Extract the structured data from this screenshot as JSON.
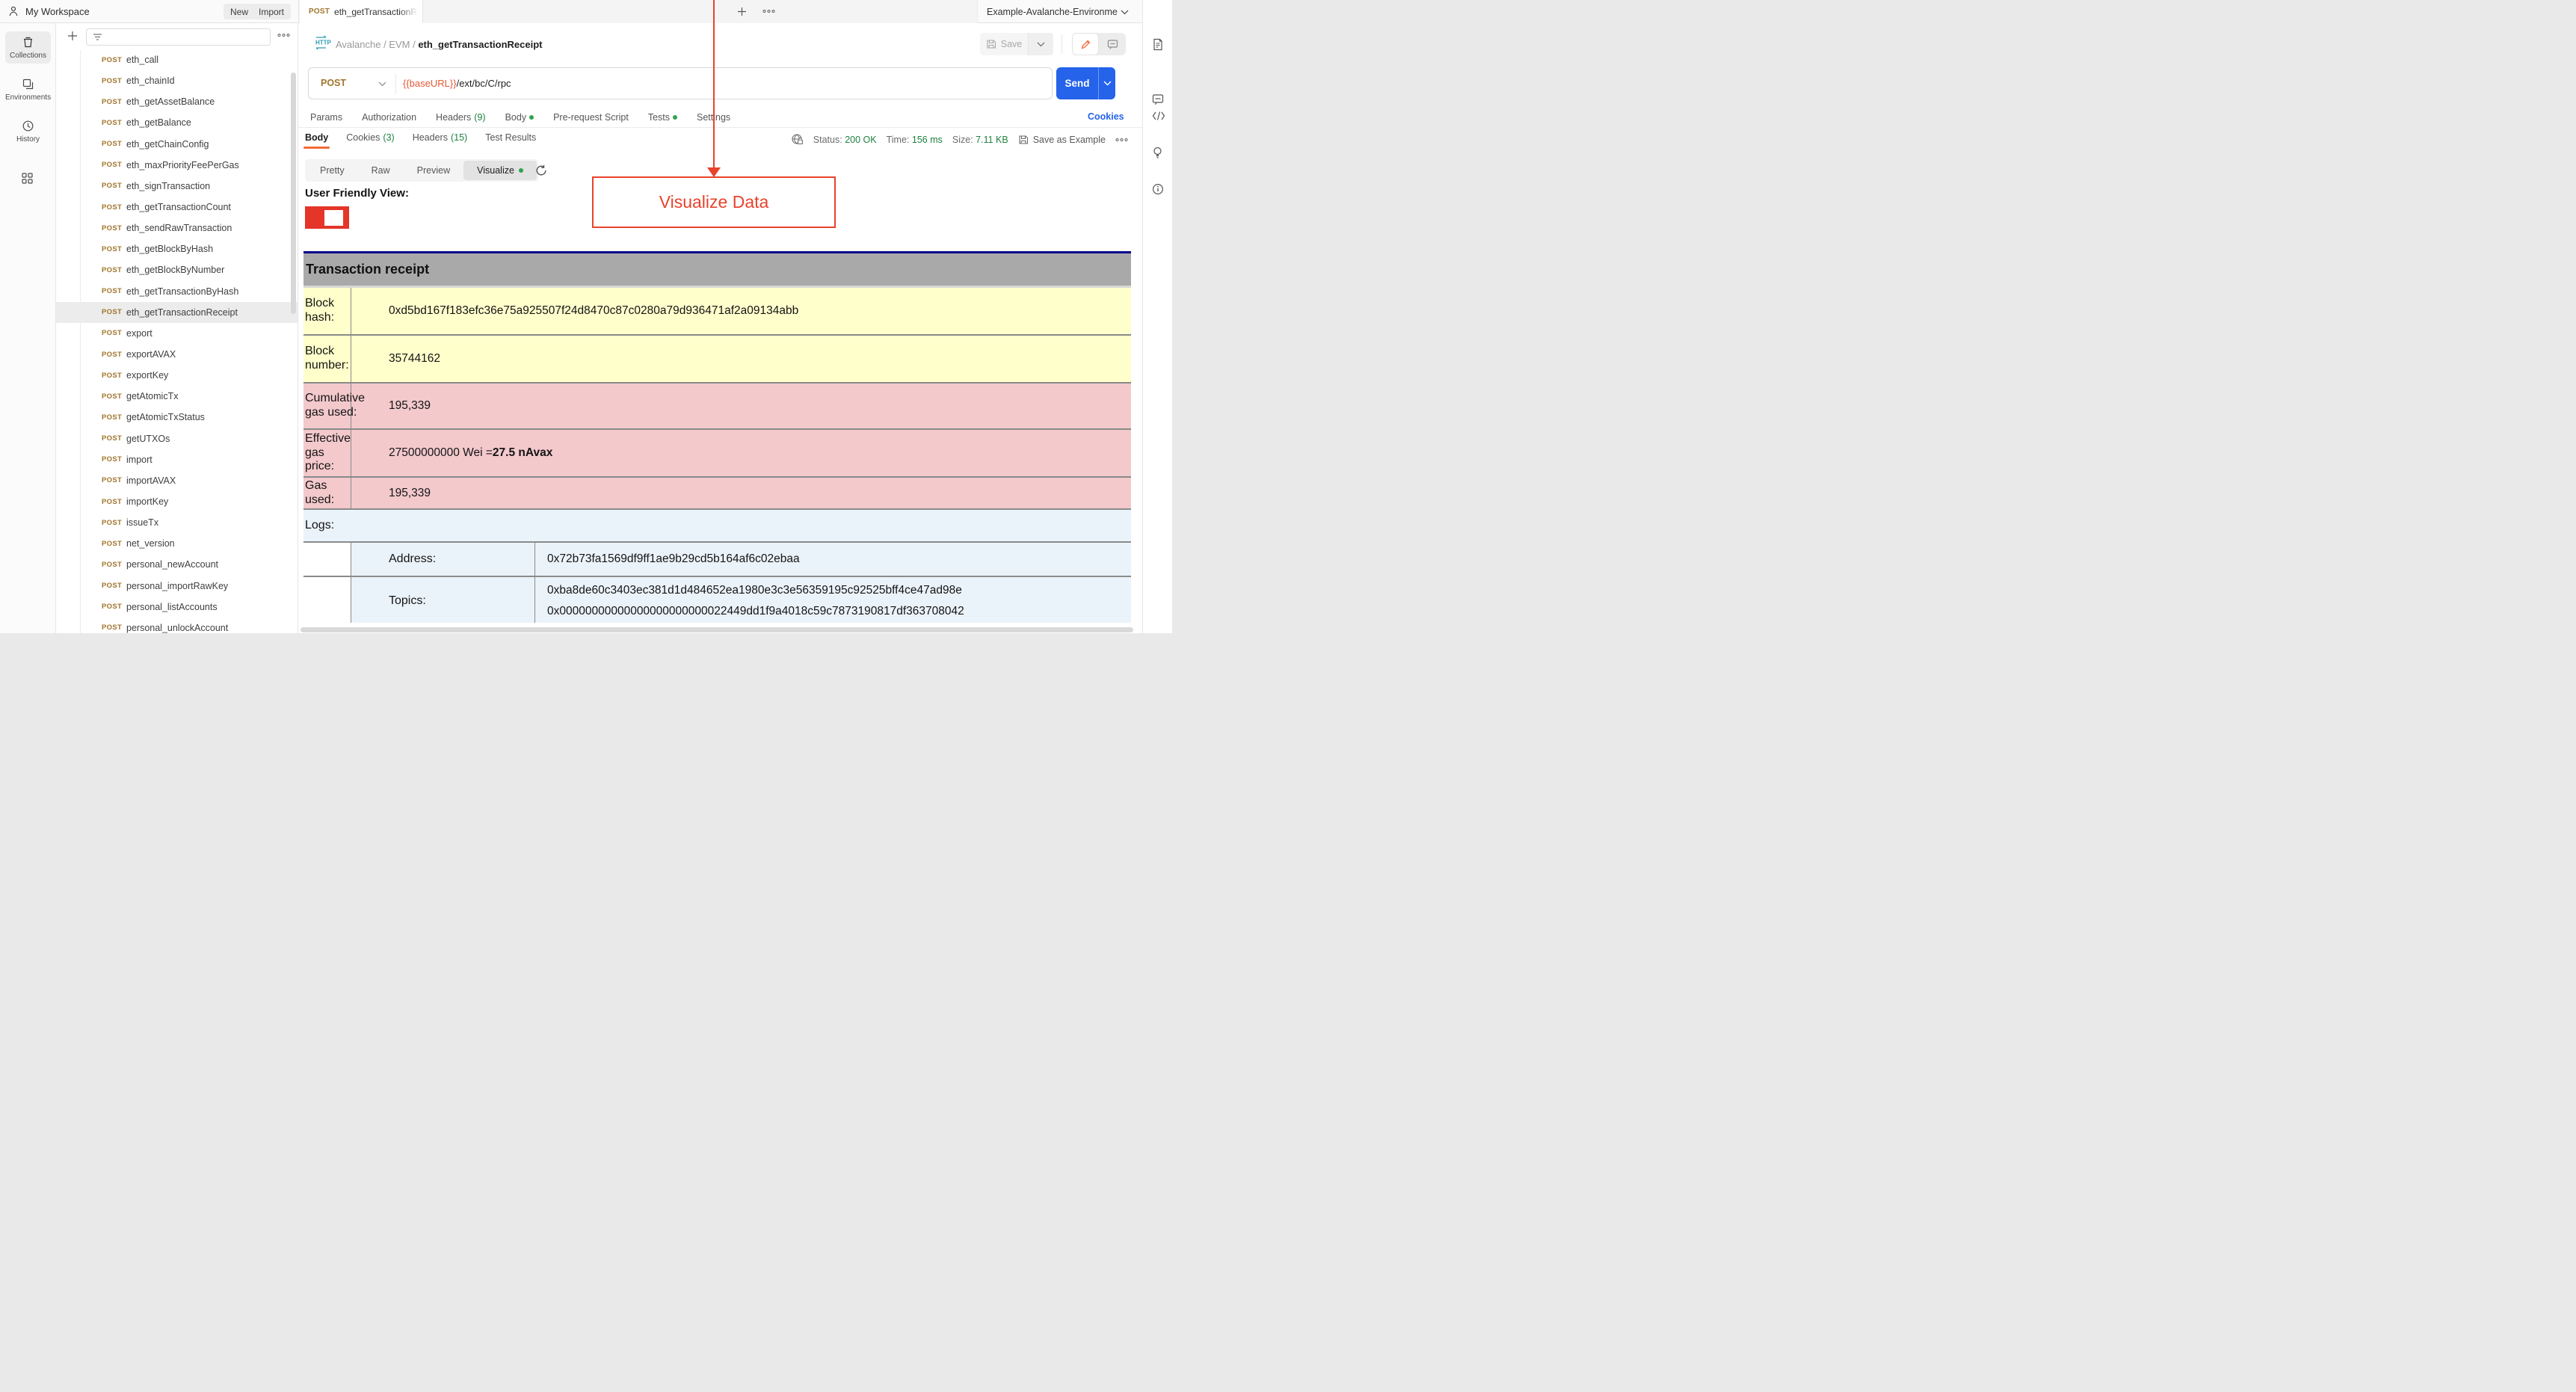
{
  "topbar": {
    "workspace_title": "My Workspace",
    "new_button": "New",
    "import_button": "Import",
    "tab_method": "POST",
    "tab_title": "eth_getTransactionRece",
    "environment_name": "Example-Avalanche-Environme"
  },
  "left_rail": {
    "collections_label": "Collections",
    "environments_label": "Environments",
    "history_label": "History"
  },
  "sidebar": {
    "selected_index": 12,
    "items": [
      {
        "method": "POST",
        "name": "eth_call"
      },
      {
        "method": "POST",
        "name": "eth_chainId"
      },
      {
        "method": "POST",
        "name": "eth_getAssetBalance"
      },
      {
        "method": "POST",
        "name": "eth_getBalance"
      },
      {
        "method": "POST",
        "name": "eth_getChainConfig"
      },
      {
        "method": "POST",
        "name": "eth_maxPriorityFeePerGas"
      },
      {
        "method": "POST",
        "name": "eth_signTransaction"
      },
      {
        "method": "POST",
        "name": "eth_getTransactionCount"
      },
      {
        "method": "POST",
        "name": "eth_sendRawTransaction"
      },
      {
        "method": "POST",
        "name": "eth_getBlockByHash"
      },
      {
        "method": "POST",
        "name": "eth_getBlockByNumber"
      },
      {
        "method": "POST",
        "name": "eth_getTransactionByHash"
      },
      {
        "method": "POST",
        "name": "eth_getTransactionReceipt"
      },
      {
        "method": "POST",
        "name": "export"
      },
      {
        "method": "POST",
        "name": "exportAVAX"
      },
      {
        "method": "POST",
        "name": "exportKey"
      },
      {
        "method": "POST",
        "name": "getAtomicTx"
      },
      {
        "method": "POST",
        "name": "getAtomicTxStatus"
      },
      {
        "method": "POST",
        "name": "getUTXOs"
      },
      {
        "method": "POST",
        "name": "import"
      },
      {
        "method": "POST",
        "name": "importAVAX"
      },
      {
        "method": "POST",
        "name": "importKey"
      },
      {
        "method": "POST",
        "name": "issueTx"
      },
      {
        "method": "POST",
        "name": "net_version"
      },
      {
        "method": "POST",
        "name": "personal_newAccount"
      },
      {
        "method": "POST",
        "name": "personal_importRawKey"
      },
      {
        "method": "POST",
        "name": "personal_listAccounts"
      },
      {
        "method": "POST",
        "name": "personal_unlockAccount"
      }
    ]
  },
  "request": {
    "breadcrumb": [
      "Avalanche",
      "EVM"
    ],
    "breadcrumb_current": "eth_getTransactionReceipt",
    "save_button": "Save",
    "method": "POST",
    "url_variable": "{{baseURL}}",
    "url_path": "/ext/bc/C/rpc",
    "send_button": "Send",
    "tabs": [
      {
        "label": "Params"
      },
      {
        "label": "Authorization"
      },
      {
        "label": "Headers",
        "count": "(9)"
      },
      {
        "label": "Body",
        "dot": true
      },
      {
        "label": "Pre-request Script"
      },
      {
        "label": "Tests",
        "dot": true
      },
      {
        "label": "Settings"
      }
    ],
    "cookies_link": "Cookies"
  },
  "response": {
    "tabs": [
      {
        "label": "Body",
        "active": true
      },
      {
        "label": "Cookies",
        "count": "(3)"
      },
      {
        "label": "Headers",
        "count": "(15)"
      },
      {
        "label": "Test Results"
      }
    ],
    "status_label": "Status:",
    "status_value": "200 OK",
    "time_label": "Time:",
    "time_value": "156 ms",
    "size_label": "Size:",
    "size_value": "7.11 KB",
    "save_as_example": "Save as Example",
    "view_tabs": [
      {
        "label": "Pretty"
      },
      {
        "label": "Raw"
      },
      {
        "label": "Preview"
      },
      {
        "label": "Visualize",
        "active": true,
        "dot": true
      }
    ]
  },
  "visualizer": {
    "heading": "User Friendly View:",
    "annotation_label": "Visualize Data",
    "table": {
      "title": "Transaction receipt",
      "rows": [
        {
          "label": "Block hash:",
          "value": "0xd5bd167f183efc36e75a925507f24d8470c87c0280a79d936471af2a09134abb",
          "bg": "yellow",
          "height": 62
        },
        {
          "label": "Block number:",
          "value": "35744162",
          "bg": "yellow",
          "height": 62
        },
        {
          "label": "Cumulative gas used:",
          "value": "195,339",
          "bg": "pink",
          "height": 60
        },
        {
          "label": "Effective gas price:",
          "value": "27500000000 Wei = ",
          "value_bold": "27.5 nAvax",
          "bg": "pink",
          "height": 62
        },
        {
          "label": "Gas used:",
          "value": "195,339",
          "bg": "pink",
          "height": 41
        }
      ],
      "logs_label": "Logs:",
      "logs_height": 42,
      "log_rows": [
        {
          "label": "Address:",
          "values": [
            "0x72b73fa1569df9ff1ae9b29cd5b164af6c02ebaa"
          ],
          "height": 44
        },
        {
          "label": "Topics:",
          "values": [
            "0xba8de60c3403ec381d1d484652ea1980e3c3e56359195c92525bff4ce47ad98e",
            "0x00000000000000000000000022449dd1f9a4018c59c7873190817df363708042"
          ],
          "height": 64
        }
      ]
    }
  },
  "colors": {
    "annotation_red": "#e8432d",
    "checkbox_red": "#e43528",
    "send_blue": "#2563eb",
    "link_blue": "#2563eb",
    "success_green": "#1f8140",
    "post_gold": "#a0752c",
    "accent_orange": "#f26b3a",
    "table_yellow": "#ffffcc",
    "table_pink": "#f3c9cc",
    "table_blue": "#ebf3fa",
    "table_header_gray": "#a9a9a9",
    "table_top_navy": "#00008b"
  }
}
